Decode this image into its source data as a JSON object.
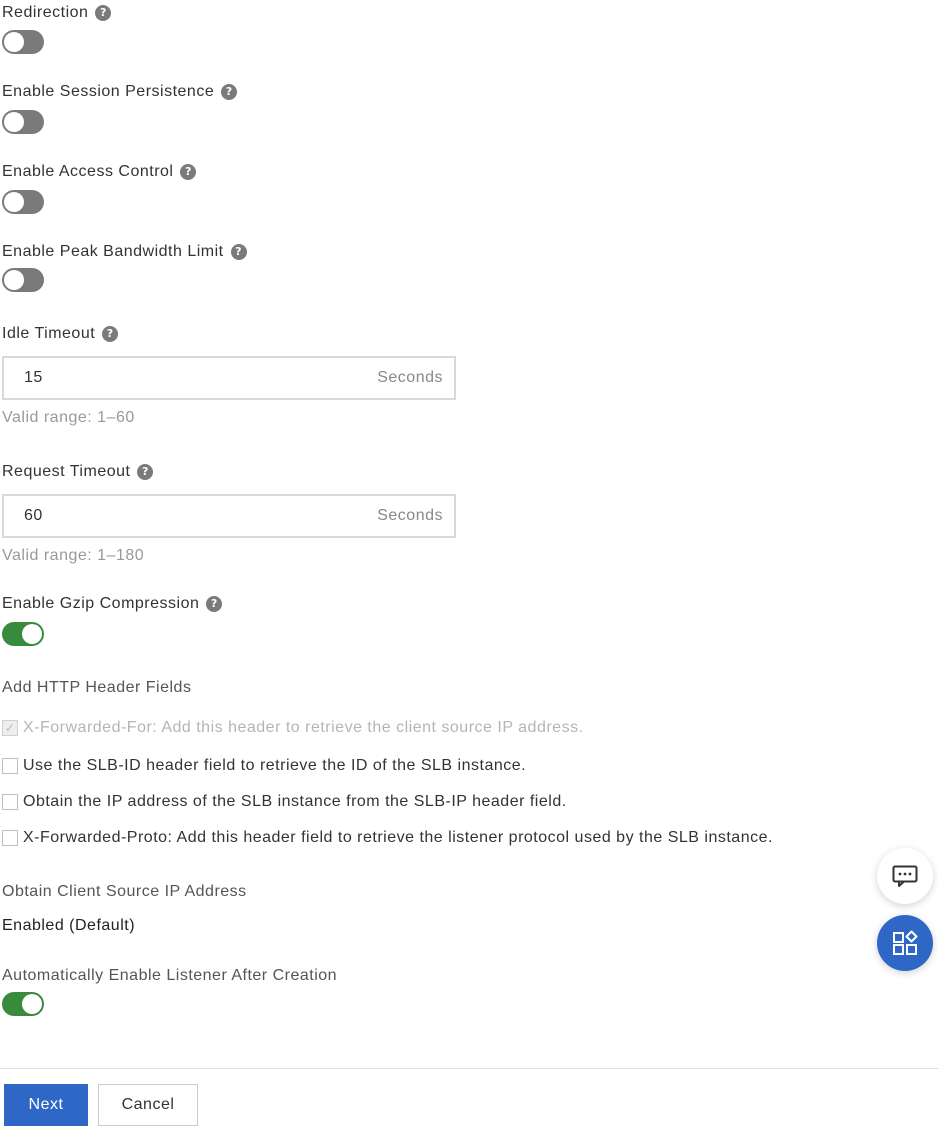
{
  "fields": {
    "redirection": {
      "label": "Redirection",
      "enabled": false
    },
    "session_persistence": {
      "label": "Enable Session Persistence",
      "enabled": false
    },
    "access_control": {
      "label": "Enable Access Control",
      "enabled": false
    },
    "peak_bandwidth": {
      "label": "Enable Peak Bandwidth Limit",
      "enabled": false
    },
    "idle_timeout": {
      "label": "Idle Timeout",
      "value": "15",
      "unit": "Seconds",
      "hint": "Valid range: 1–60"
    },
    "request_timeout": {
      "label": "Request Timeout",
      "value": "60",
      "unit": "Seconds",
      "hint": "Valid range: 1–180"
    },
    "gzip": {
      "label": "Enable Gzip Compression",
      "enabled": true
    }
  },
  "http_headers": {
    "label": "Add HTTP Header Fields",
    "options": [
      {
        "text": "X-Forwarded-For: Add this header to retrieve the client source IP address.",
        "checked": true,
        "disabled": true
      },
      {
        "text": "Use the SLB-ID header field to retrieve the ID of the SLB instance.",
        "checked": false,
        "disabled": false
      },
      {
        "text": "Obtain the IP address of the SLB instance from the SLB-IP header field.",
        "checked": false,
        "disabled": false
      },
      {
        "text": "X-Forwarded-Proto: Add this header field to retrieve the listener protocol used by the SLB instance.",
        "checked": false,
        "disabled": false
      }
    ]
  },
  "client_source_ip": {
    "label": "Obtain Client Source IP Address",
    "value": "Enabled (Default)"
  },
  "auto_enable": {
    "label": "Automatically Enable Listener After Creation",
    "enabled": true
  },
  "footer": {
    "next_label": "Next",
    "cancel_label": "Cancel"
  },
  "help_glyph": "?",
  "icons": {
    "help": "question-circle-icon",
    "chat": "chat-icon",
    "apps": "apps-icon"
  },
  "colors": {
    "switch_on": "#3a8a3e",
    "switch_off": "#7a7a7a",
    "primary": "#2f67c7"
  }
}
